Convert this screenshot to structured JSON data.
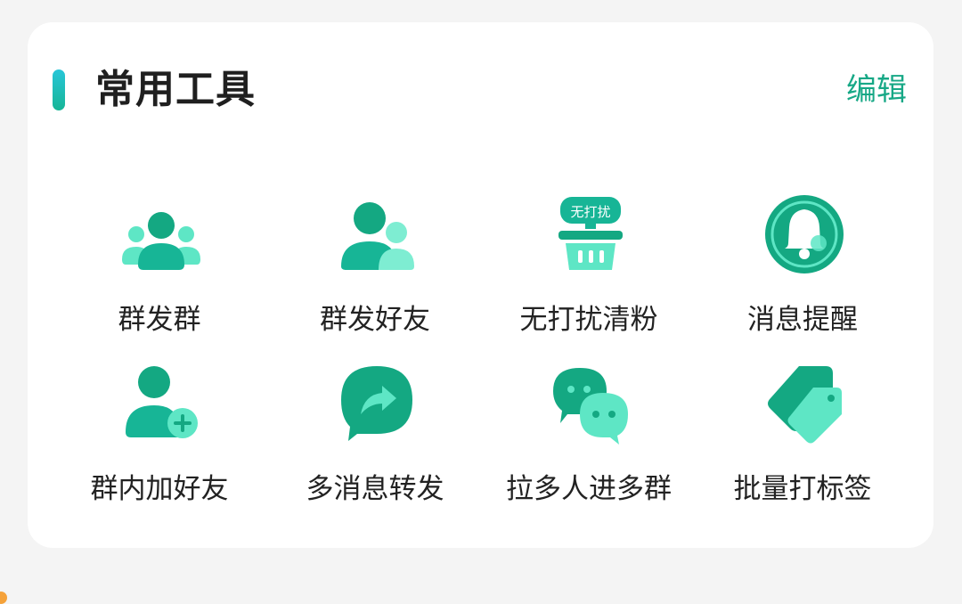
{
  "section": {
    "title": "常用工具",
    "edit_label": "编辑"
  },
  "colors": {
    "accent": "#17b596",
    "accent_dark": "#14a882",
    "accent_light": "#5ee6c5",
    "edit_text": "#17a886"
  },
  "tools": [
    {
      "label": "群发群",
      "icon": "group-broadcast-icon",
      "badge": ""
    },
    {
      "label": "群发好友",
      "icon": "friends-broadcast-icon",
      "badge": ""
    },
    {
      "label": "无打扰清粉",
      "icon": "silent-clean-icon",
      "badge": "无打扰"
    },
    {
      "label": "消息提醒",
      "icon": "bell-icon",
      "badge": ""
    },
    {
      "label": "群内加好友",
      "icon": "add-friend-icon",
      "badge": ""
    },
    {
      "label": "多消息转发",
      "icon": "forward-message-icon",
      "badge": ""
    },
    {
      "label": "拉多人进多群",
      "icon": "chat-bubbles-icon",
      "badge": ""
    },
    {
      "label": "批量打标签",
      "icon": "tags-icon",
      "badge": ""
    }
  ]
}
